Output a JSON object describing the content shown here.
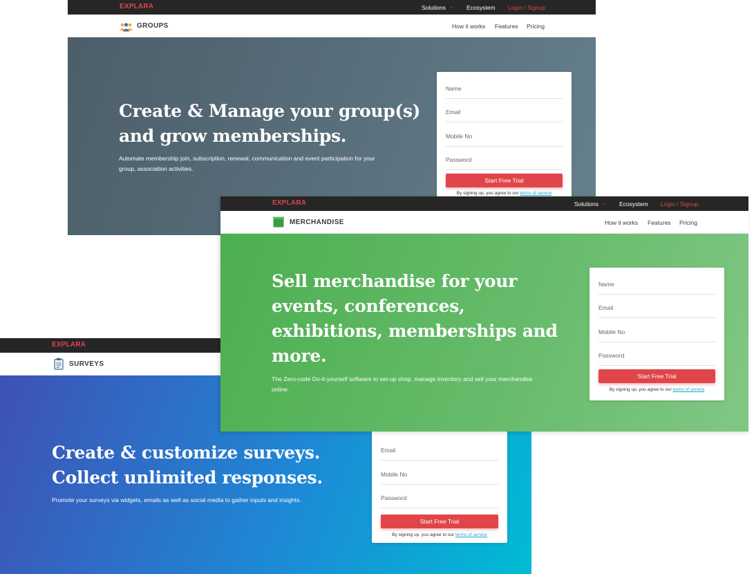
{
  "brand": {
    "logo_text": "EXPLARA",
    "logo_color": "#e0454a"
  },
  "topnav": {
    "solutions": "Solutions",
    "ecosystem": "Ecosystem",
    "login": "Login / Signup"
  },
  "subnav": {
    "how": "How it works",
    "features": "Features",
    "pricing": "Pricing"
  },
  "form": {
    "name_placeholder": "Name",
    "email_placeholder": "Email",
    "mobile_placeholder": "Mobile No",
    "password_placeholder": "Password",
    "cta_label": "Start Free Trial",
    "legal_text": "By signing up, you agree to our",
    "terms_link": "terms of service"
  },
  "groups": {
    "product_name": "GROUPS",
    "icon": "people-group-icon",
    "headline_line1": "Create & Manage your group(s)",
    "headline_line2": "and grow memberships.",
    "subtext_line1": "Automate membership join, subscription, renewal, communication and event participation for your",
    "subtext_line2": "group, association activities.",
    "bg_start": "#4c5e69",
    "bg_end": "#65808e"
  },
  "merchandise": {
    "product_name": "MERCHANDISE",
    "icon": "green-box-icon",
    "headline_line1": "Sell merchandise for your",
    "headline_line2": "events, conferences,",
    "headline_line3": "exhibitions, memberships and",
    "headline_line4": "more.",
    "subtext_line1": "The Zero-code Do-it-yourself software to set-up shop, manage inventory and sell your merchandise",
    "subtext_line2": "online.",
    "bg_start": "#4caf50",
    "bg_end": "#81c784"
  },
  "surveys": {
    "product_name": "SURVEYS",
    "icon": "clipboard-icon",
    "headline_line1": "Create & customize surveys.",
    "headline_line2": "Collect unlimited responses.",
    "subtext_line1": "Promote your surveys via widgets, emails as well as social media to gather inputs and insights.",
    "bg_start": "#3f51b5",
    "bg_end": "#00bcd4"
  }
}
